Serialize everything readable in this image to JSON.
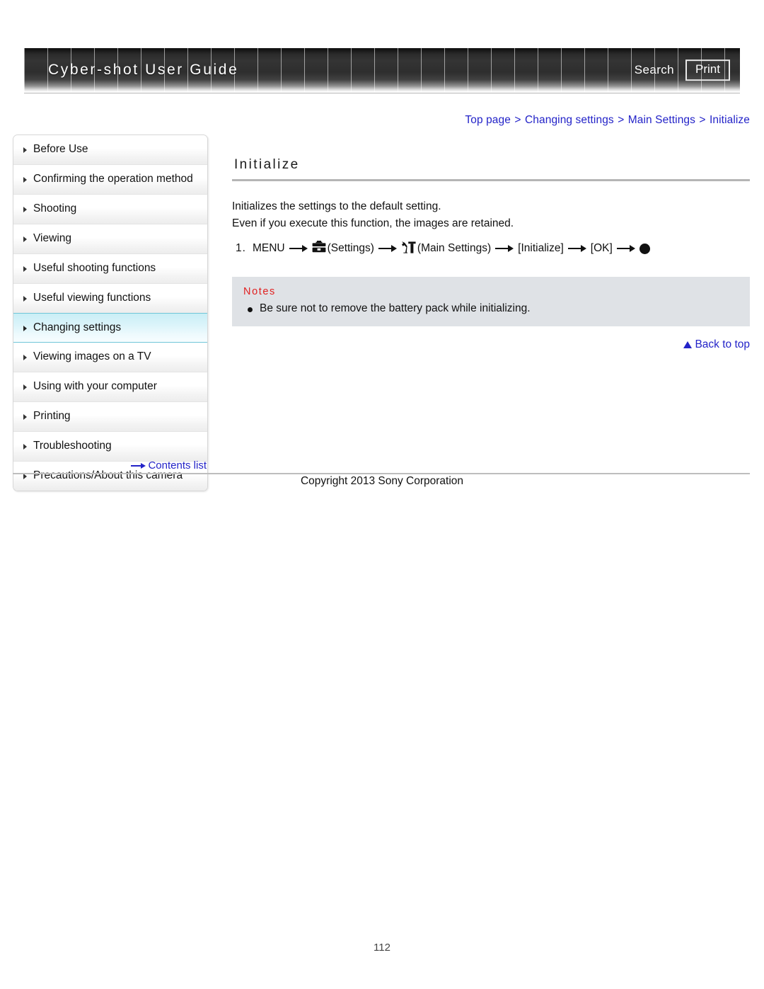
{
  "header": {
    "title": "Cyber-shot User Guide",
    "search_label": "Search",
    "print_label": "Print"
  },
  "breadcrumb": {
    "separator": ">",
    "items": [
      {
        "label": "Top page"
      },
      {
        "label": "Changing settings"
      },
      {
        "label": "Main Settings"
      },
      {
        "label": "Initialize"
      }
    ]
  },
  "sidebar": {
    "items": [
      {
        "label": "Before Use",
        "active": false
      },
      {
        "label": "Confirming the operation method",
        "active": false
      },
      {
        "label": "Shooting",
        "active": false
      },
      {
        "label": "Viewing",
        "active": false
      },
      {
        "label": "Useful shooting functions",
        "active": false
      },
      {
        "label": "Useful viewing functions",
        "active": false
      },
      {
        "label": "Changing settings",
        "active": true
      },
      {
        "label": "Viewing images on a TV",
        "active": false
      },
      {
        "label": "Using with your computer",
        "active": false
      },
      {
        "label": "Printing",
        "active": false
      },
      {
        "label": "Troubleshooting",
        "active": false
      },
      {
        "label": "Precautions/About this camera",
        "active": false
      }
    ],
    "contents_link": "Contents list"
  },
  "main": {
    "title": "Initialize",
    "paragraph_1": "Initializes the settings to the default setting.",
    "paragraph_2": "Even if you execute this function, the images are retained.",
    "step": {
      "number": "1.",
      "menu_label": "MENU",
      "settings_label": "(Settings)",
      "main_settings_label": "(Main Settings)",
      "initialize_label": "[Initialize]",
      "ok_label": "[OK]"
    },
    "notes": {
      "title": "Notes",
      "items": [
        "Be sure not to remove the battery pack while initializing."
      ]
    },
    "back_to_top": "Back to top"
  },
  "footer": {
    "copyright": "Copyright 2013 Sony Corporation",
    "page_number": "112"
  },
  "colors": {
    "link": "#2323c8",
    "notes_title": "#e02020",
    "notes_bg": "#dfe2e6",
    "active_nav": "#c9eef6"
  }
}
